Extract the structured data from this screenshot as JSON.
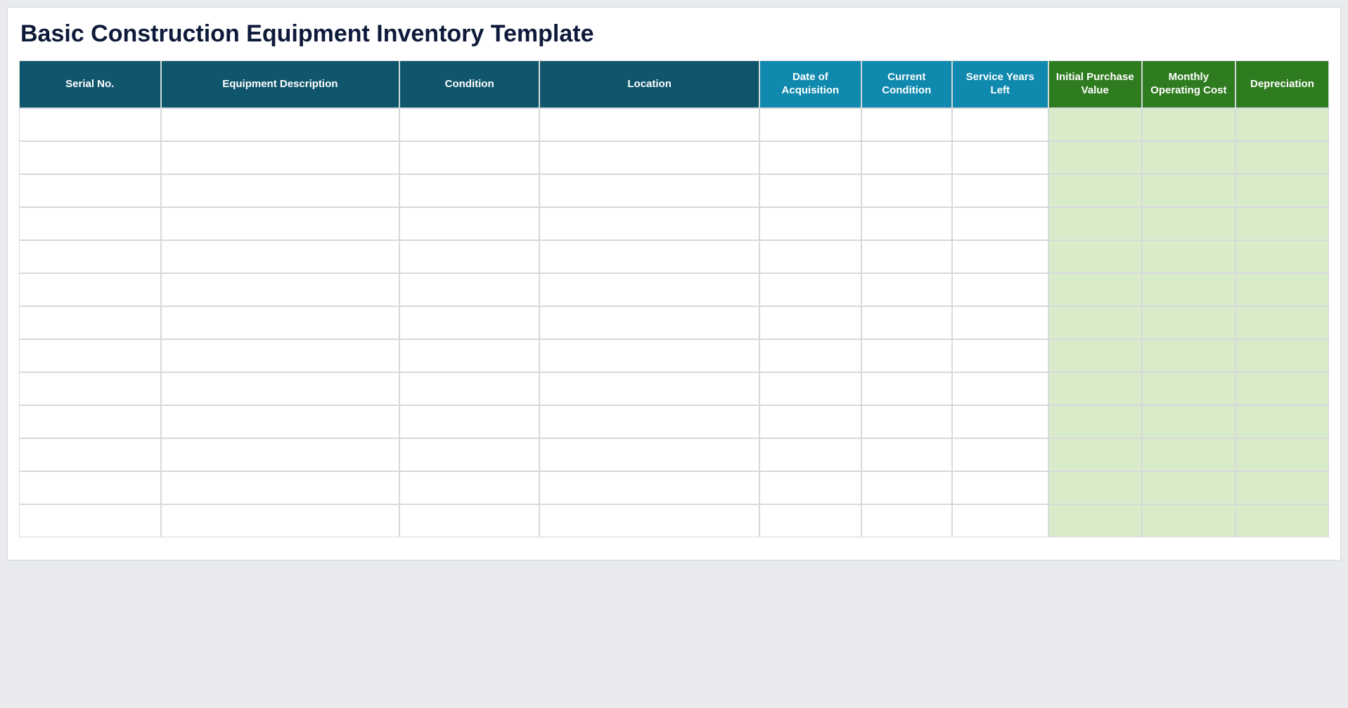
{
  "title": "Basic Construction Equipment Inventory Template",
  "columns": [
    {
      "key": "serial",
      "label": "Serial No.",
      "group": "dark",
      "col_class": "c-serial",
      "money": false
    },
    {
      "key": "desc",
      "label": "Equipment Description",
      "group": "dark",
      "col_class": "c-desc",
      "money": false
    },
    {
      "key": "cond",
      "label": "Condition",
      "group": "dark",
      "col_class": "c-cond",
      "money": false
    },
    {
      "key": "loc",
      "label": "Location",
      "group": "dark",
      "col_class": "c-loc",
      "money": false
    },
    {
      "key": "date",
      "label": "Date of Acquisition",
      "group": "teal",
      "col_class": "c-date",
      "money": false
    },
    {
      "key": "ccond",
      "label": "Current Condition",
      "group": "teal",
      "col_class": "c-ccond",
      "money": false
    },
    {
      "key": "years",
      "label": "Service Years Left",
      "group": "teal",
      "col_class": "c-years",
      "money": false
    },
    {
      "key": "init",
      "label": "Initial Purchase Value",
      "group": "green",
      "col_class": "c-init",
      "money": true
    },
    {
      "key": "month",
      "label": "Monthly Operating Cost",
      "group": "green",
      "col_class": "c-month",
      "money": true
    },
    {
      "key": "depr",
      "label": "Depreciation",
      "group": "green",
      "col_class": "c-depr",
      "money": true
    }
  ],
  "row_count": 13,
  "rows": [
    {
      "serial": "",
      "desc": "",
      "cond": "",
      "loc": "",
      "date": "",
      "ccond": "",
      "years": "",
      "init": "",
      "month": "",
      "depr": ""
    },
    {
      "serial": "",
      "desc": "",
      "cond": "",
      "loc": "",
      "date": "",
      "ccond": "",
      "years": "",
      "init": "",
      "month": "",
      "depr": ""
    },
    {
      "serial": "",
      "desc": "",
      "cond": "",
      "loc": "",
      "date": "",
      "ccond": "",
      "years": "",
      "init": "",
      "month": "",
      "depr": ""
    },
    {
      "serial": "",
      "desc": "",
      "cond": "",
      "loc": "",
      "date": "",
      "ccond": "",
      "years": "",
      "init": "",
      "month": "",
      "depr": ""
    },
    {
      "serial": "",
      "desc": "",
      "cond": "",
      "loc": "",
      "date": "",
      "ccond": "",
      "years": "",
      "init": "",
      "month": "",
      "depr": ""
    },
    {
      "serial": "",
      "desc": "",
      "cond": "",
      "loc": "",
      "date": "",
      "ccond": "",
      "years": "",
      "init": "",
      "month": "",
      "depr": ""
    },
    {
      "serial": "",
      "desc": "",
      "cond": "",
      "loc": "",
      "date": "",
      "ccond": "",
      "years": "",
      "init": "",
      "month": "",
      "depr": ""
    },
    {
      "serial": "",
      "desc": "",
      "cond": "",
      "loc": "",
      "date": "",
      "ccond": "",
      "years": "",
      "init": "",
      "month": "",
      "depr": ""
    },
    {
      "serial": "",
      "desc": "",
      "cond": "",
      "loc": "",
      "date": "",
      "ccond": "",
      "years": "",
      "init": "",
      "month": "",
      "depr": ""
    },
    {
      "serial": "",
      "desc": "",
      "cond": "",
      "loc": "",
      "date": "",
      "ccond": "",
      "years": "",
      "init": "",
      "month": "",
      "depr": ""
    },
    {
      "serial": "",
      "desc": "",
      "cond": "",
      "loc": "",
      "date": "",
      "ccond": "",
      "years": "",
      "init": "",
      "month": "",
      "depr": ""
    },
    {
      "serial": "",
      "desc": "",
      "cond": "",
      "loc": "",
      "date": "",
      "ccond": "",
      "years": "",
      "init": "",
      "month": "",
      "depr": ""
    },
    {
      "serial": "",
      "desc": "",
      "cond": "",
      "loc": "",
      "date": "",
      "ccond": "",
      "years": "",
      "init": "",
      "month": "",
      "depr": ""
    }
  ]
}
